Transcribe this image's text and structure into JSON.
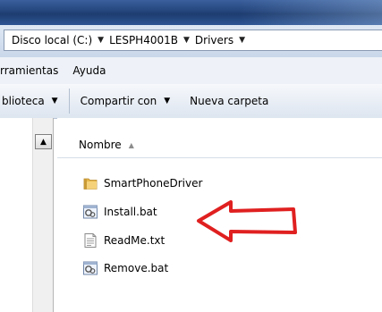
{
  "address": {
    "crumbs": [
      "Disco local (C:)",
      "LESPH4001B",
      "Drivers"
    ]
  },
  "menu": [
    "rramientas",
    "Ayuda"
  ],
  "toolbar": {
    "library_label": "blioteca",
    "share_label": "Compartir con",
    "new_folder_label": "Nueva carpeta"
  },
  "columns": {
    "name": "Nombre"
  },
  "files": [
    {
      "name": "SmartPhoneDriver",
      "icon": "folder-icon"
    },
    {
      "name": "Install.bat",
      "icon": "batch-file-icon"
    },
    {
      "name": "ReadMe.txt",
      "icon": "text-file-icon"
    },
    {
      "name": "Remove.bat",
      "icon": "batch-file-icon"
    }
  ],
  "colors": {
    "annotation_arrow": "#e02020",
    "titlebar": "#24457c",
    "folder": "#e6b84a"
  }
}
